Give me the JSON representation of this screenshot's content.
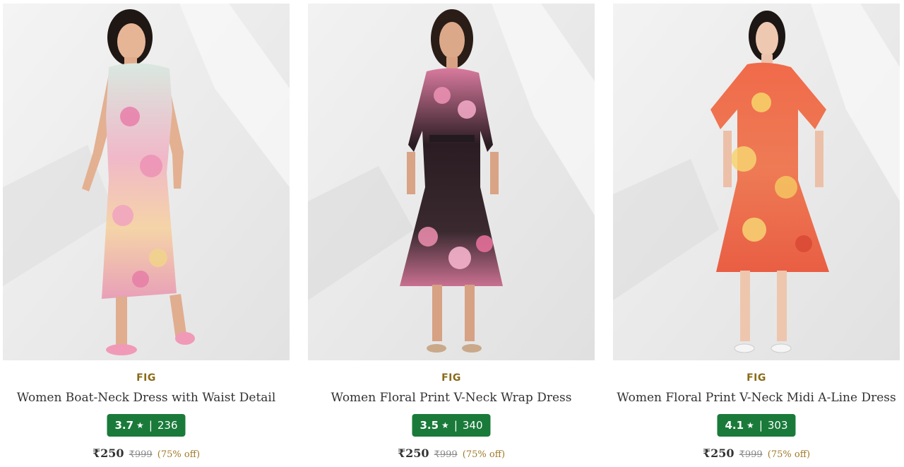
{
  "products": [
    {
      "brand": "FIG",
      "name": "Women Boat-Neck Dress with Waist Detail",
      "rating": "3.7",
      "reviews": "236",
      "price": "₹250",
      "mrp": "₹999",
      "discount": "(75% off)",
      "image_icon": "product-photo-boat-neck-dress"
    },
    {
      "brand": "FIG",
      "name": "Women Floral Print V-Neck Wrap Dress",
      "rating": "3.5",
      "reviews": "340",
      "price": "₹250",
      "mrp": "₹999",
      "discount": "(75% off)",
      "image_icon": "product-photo-wrap-dress"
    },
    {
      "brand": "FIG",
      "name": "Women Floral Print V-Neck Midi A-Line Dress",
      "rating": "4.1",
      "reviews": "303",
      "price": "₹250",
      "mrp": "₹999",
      "discount": "(75% off)",
      "image_icon": "product-photo-midi-dress"
    }
  ],
  "rating_separator": "|",
  "star_glyph": "★",
  "colors": {
    "brand_text": "#8b6b1a",
    "rating_badge": "#1a7a3a",
    "discount_text": "#a07a2a"
  }
}
